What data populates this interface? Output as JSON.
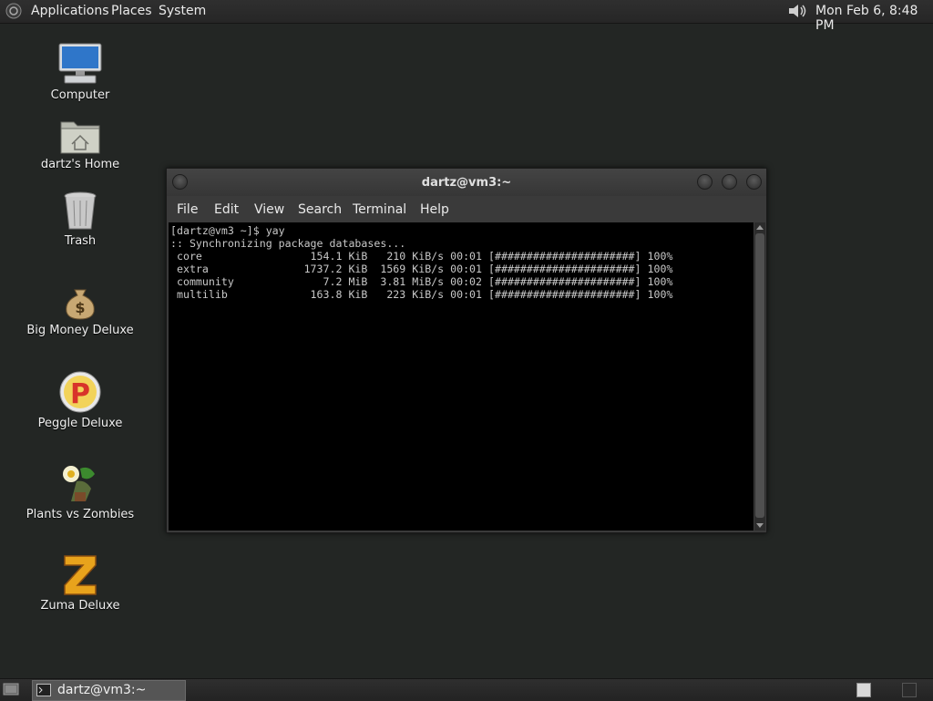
{
  "top_panel": {
    "applications": "Applications",
    "places": "Places",
    "system": "System",
    "clock": "Mon Feb  6,  8:48 PM"
  },
  "desktop_icons": [
    {
      "label": "Computer",
      "icon": "computer-icon"
    },
    {
      "label": "dartz's Home",
      "icon": "home-folder-icon"
    },
    {
      "label": "Trash",
      "icon": "trash-icon"
    },
    {
      "label": "Big Money Deluxe",
      "icon": "money-bag-icon"
    },
    {
      "label": "Peggle Deluxe",
      "icon": "peggle-icon"
    },
    {
      "label": "Plants vs Zombies",
      "icon": "plants-vs-zombies-icon"
    },
    {
      "label": "Zuma Deluxe",
      "icon": "zuma-icon"
    }
  ],
  "terminal": {
    "title": "dartz@vm3:~",
    "menu": [
      "File",
      "Edit",
      "View",
      "Search",
      "Terminal",
      "Help"
    ],
    "lines": [
      "[dartz@vm3 ~]$ yay",
      ":: Synchronizing package databases...",
      " core                 154.1 KiB   210 KiB/s 00:01 [######################] 100%",
      " extra               1737.2 KiB  1569 KiB/s 00:01 [######################] 100%",
      " community              7.2 MiB  3.81 MiB/s 00:02 [######################] 100%",
      " multilib             163.8 KiB   223 KiB/s 00:01 [######################] 100%"
    ]
  },
  "bottom_panel": {
    "task_label": "dartz@vm3:~"
  }
}
